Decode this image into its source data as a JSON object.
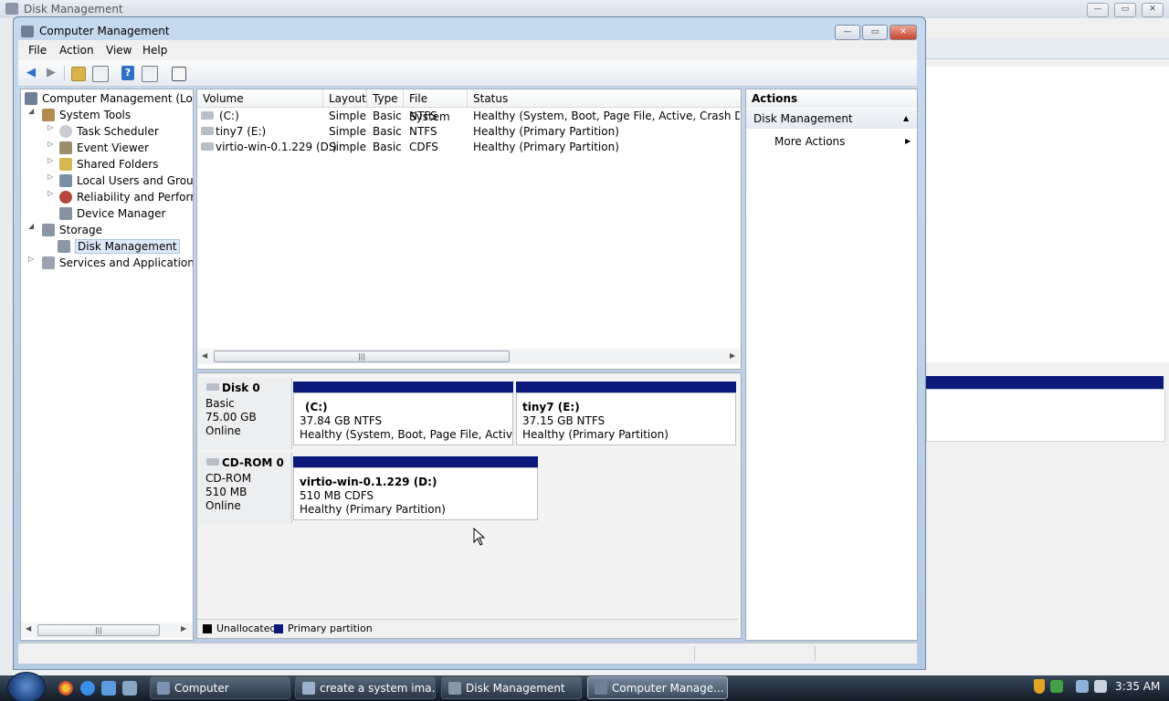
{
  "background_window": {
    "title": "Disk Management"
  },
  "window": {
    "title": "Computer Management",
    "minimize": "—",
    "maximize": "▭",
    "close": "✕"
  },
  "menu": [
    "File",
    "Action",
    "View",
    "Help"
  ],
  "toolbar": [
    "back-icon",
    "forward-icon",
    "up-folder-icon",
    "show-hide-tree-icon",
    "help-icon",
    "show-hide-action-pane-icon",
    "properties-icon"
  ],
  "tree": {
    "root": "Computer Management (Local",
    "system_tools": "System Tools",
    "task_scheduler": "Task Scheduler",
    "event_viewer": "Event Viewer",
    "shared_folders": "Shared Folders",
    "local_users": "Local Users and Groups",
    "reliability": "Reliability and Performa",
    "device_manager": "Device Manager",
    "storage": "Storage",
    "disk_management": "Disk Management",
    "services": "Services and Applications"
  },
  "volume_list": {
    "columns": [
      "Volume",
      "Layout",
      "Type",
      "File System",
      "Status"
    ],
    "rows": [
      [
        "(C:)",
        "Simple",
        "Basic",
        "NTFS",
        "Healthy (System, Boot, Page File, Active, Crash Dump, P"
      ],
      [
        "tiny7 (E:)",
        "Simple",
        "Basic",
        "NTFS",
        "Healthy (Primary Partition)"
      ],
      [
        "virtio-win-0.1.229 (D:)",
        "Simple",
        "Basic",
        "CDFS",
        "Healthy (Primary Partition)"
      ]
    ]
  },
  "disks": {
    "disk0": {
      "name": "Disk 0",
      "type": "Basic",
      "size": "75.00 GB",
      "status": "Online",
      "partitions": [
        {
          "name": "(C:)",
          "size": "37.84 GB NTFS",
          "status": "Healthy (System, Boot, Page File, Active, Cr"
        },
        {
          "name": "tiny7  (E:)",
          "size": "37.15 GB NTFS",
          "status": "Healthy (Primary Partition)"
        }
      ]
    },
    "cdrom0": {
      "name": "CD-ROM 0",
      "type": "CD-ROM",
      "size": "510 MB",
      "status": "Online",
      "partitions": [
        {
          "name": "virtio-win-0.1.229  (D:)",
          "size": "510 MB CDFS",
          "status": "Healthy (Primary Partition)"
        }
      ]
    }
  },
  "legend": {
    "unallocated": "Unallocated",
    "primary": "Primary partition",
    "unallocated_color": "#000000",
    "primary_color": "#0b1a7a"
  },
  "actions": {
    "header": "Actions",
    "section": "Disk Management",
    "more": "More Actions"
  },
  "taskbar": {
    "buttons": [
      "Computer",
      "create a system ima...",
      "Disk Management",
      "Computer Manage..."
    ],
    "clock": "3:35 AM"
  }
}
